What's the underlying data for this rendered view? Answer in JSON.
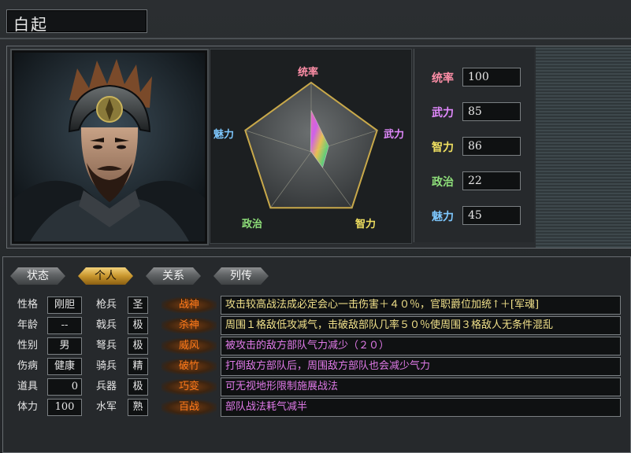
{
  "header": {
    "name": "白起"
  },
  "portrait": {
    "subject": "general-portrait"
  },
  "radar": {
    "labels": {
      "top": "统率",
      "right": "武力",
      "bottom_right": "智力",
      "bottom_left": "政治",
      "left": "魅力"
    },
    "colors": {
      "top": "#ff8fa8",
      "right": "#e38aff",
      "bottom_right": "#f0e060",
      "bottom_left": "#8fe07a",
      "left": "#7ec8ff"
    }
  },
  "stats": [
    {
      "label": "统率",
      "value": "100",
      "color": "#ff8fa8"
    },
    {
      "label": "武力",
      "value": "85",
      "color": "#e38aff"
    },
    {
      "label": "智力",
      "value": "86",
      "color": "#f0e060"
    },
    {
      "label": "政治",
      "value": "22",
      "color": "#8fe07a"
    },
    {
      "label": "魅力",
      "value": "45",
      "color": "#7ec8ff"
    }
  ],
  "tabs": [
    {
      "label": "状态",
      "active": false
    },
    {
      "label": "个人",
      "active": true
    },
    {
      "label": "关系",
      "active": false
    },
    {
      "label": "列传",
      "active": false
    }
  ],
  "personal": [
    {
      "label": "性格",
      "value": "刚胆"
    },
    {
      "label": "年龄",
      "value": "--"
    },
    {
      "label": "性别",
      "value": "男"
    },
    {
      "label": "伤病",
      "value": "健康"
    },
    {
      "label": "道具",
      "value": "0"
    },
    {
      "label": "体力",
      "value": "100"
    }
  ],
  "aptitude": [
    {
      "label": "枪兵",
      "value": "圣"
    },
    {
      "label": "戟兵",
      "value": "极"
    },
    {
      "label": "弩兵",
      "value": "极"
    },
    {
      "label": "骑兵",
      "value": "精"
    },
    {
      "label": "兵器",
      "value": "极"
    },
    {
      "label": "水军",
      "value": "熟"
    }
  ],
  "skills": [
    {
      "name": "战神",
      "desc": "攻击较高战法成必定会心一击伤害＋４０％，官职爵位加统↑＋[军魂]",
      "color": "#f0e08a"
    },
    {
      "name": "杀神",
      "desc": "周围１格敌低攻减气，击破敌部队几率５０％使周围３格敌人无条件混乱",
      "color": "#f0e08a"
    },
    {
      "name": "威风",
      "desc": "被攻击的敌方部队气力减少（２０）",
      "color": "#e07ae8"
    },
    {
      "name": "破竹",
      "desc": "打倒敌方部队后，周围敌方部队也会减少气力",
      "color": "#e07ae8"
    },
    {
      "name": "巧变",
      "desc": "可无视地形限制施展战法",
      "color": "#e07ae8"
    },
    {
      "name": "百战",
      "desc": "部队战法耗气减半",
      "color": "#e07ae8"
    }
  ]
}
